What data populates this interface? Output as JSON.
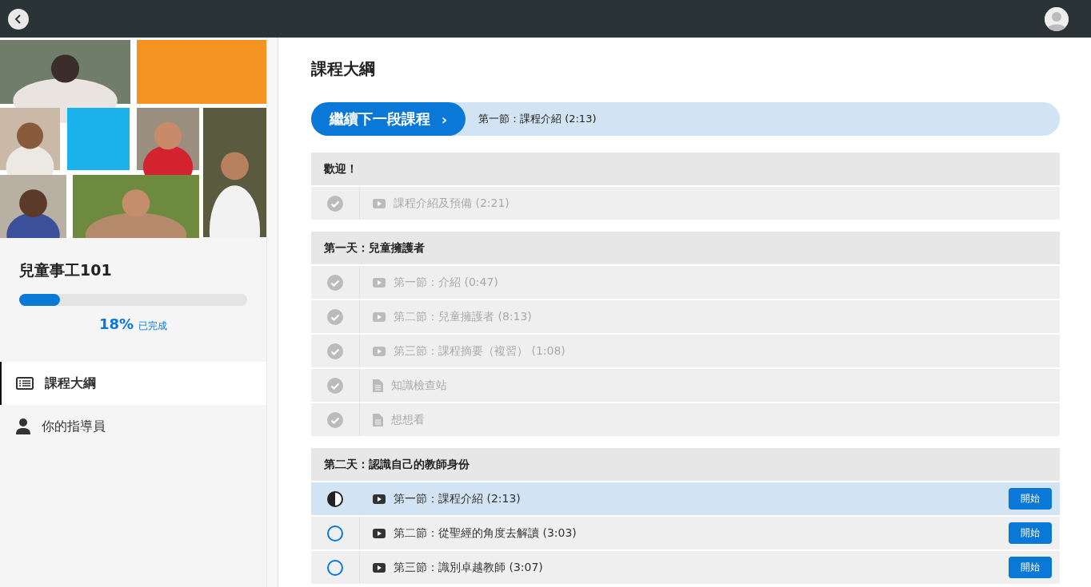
{
  "course": {
    "title": "兒童事工101",
    "progress": {
      "level": 0.18,
      "percent": "18%",
      "label": "已完成"
    }
  },
  "nav": [
    {
      "label": "課程大綱",
      "selected": true
    },
    {
      "label": "你的指導員",
      "selected": false
    }
  ],
  "main": {
    "title": "課程大綱",
    "continue": {
      "button": "繼續下一段課程",
      "arrow": "›",
      "next": "第一節：課程介紹 (2:13)"
    },
    "sections": [
      {
        "title": "歡迎！",
        "lessons": [
          {
            "title": "課程介紹及預備 (2:21)",
            "kind": "video",
            "completed": true
          }
        ]
      },
      {
        "title": "第一天：兒童擁護者",
        "lessons": [
          {
            "title": "第一節：介紹 (0:47)",
            "kind": "video",
            "completed": true
          },
          {
            "title": "第二節：兒童擁護者 (8:13)",
            "kind": "video",
            "completed": true
          },
          {
            "title": "第三節：課程摘要（複習） (1:08)",
            "kind": "video",
            "completed": true
          },
          {
            "title": "知識檢查站",
            "kind": "document",
            "completed": true
          },
          {
            "title": "想想看",
            "kind": "document",
            "completed": true
          }
        ]
      },
      {
        "title": "第二天：認識自己的教師身份",
        "lessons": [
          {
            "title": "第一節：課程介紹 (2:13)",
            "kind": "video",
            "completed": false,
            "started": true,
            "selected": true,
            "action": "開始"
          },
          {
            "title": "第二節：從聖經的角度去解讀 (3:03)",
            "kind": "video",
            "completed": false,
            "started": false,
            "selected": false,
            "action": "開始"
          },
          {
            "title": "第三節：識別卓越教師 (3:07)",
            "kind": "video",
            "completed": false,
            "started": false,
            "selected": false,
            "action": "開始"
          }
        ]
      }
    ]
  }
}
